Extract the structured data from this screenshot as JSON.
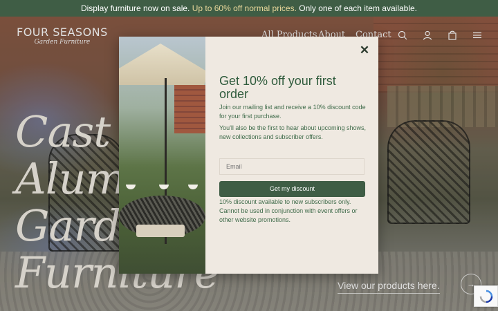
{
  "announcement": {
    "part1": "Display furniture now on sale. ",
    "highlight": "Up to 60% off normal prices.",
    "part2": " Only one of each item available."
  },
  "logo": {
    "main": "FOUR SEASONS",
    "sub": "Garden Furniture"
  },
  "nav": [
    "All Products",
    "About",
    "Contact"
  ],
  "header_icons": [
    "search-icon",
    "account-icon",
    "cart-icon",
    "menu-icon"
  ],
  "hero": {
    "title_lines": [
      "Cast",
      "Alumi",
      "Garde",
      "Furniture"
    ],
    "cta": "View our products here.",
    "arrow": "→"
  },
  "popup": {
    "close": "✕",
    "title": "Get 10% off your first order",
    "text1": "Join our mailing list and receive a 10% discount code for your first purchase.",
    "text2": "You'll also be the first to hear about upcoming shows, new collections and subscriber offers.",
    "email_placeholder": "Email",
    "button": "Get my discount",
    "disclaimer": "10% discount available to new subscribers only. Cannot be used in conjunction with event offers or other website promotions."
  },
  "colors": {
    "brand_green": "#3f5d45",
    "highlight": "#e8d79a",
    "popup_bg": "#efe9e1",
    "text_green": "#2f5b3c"
  }
}
